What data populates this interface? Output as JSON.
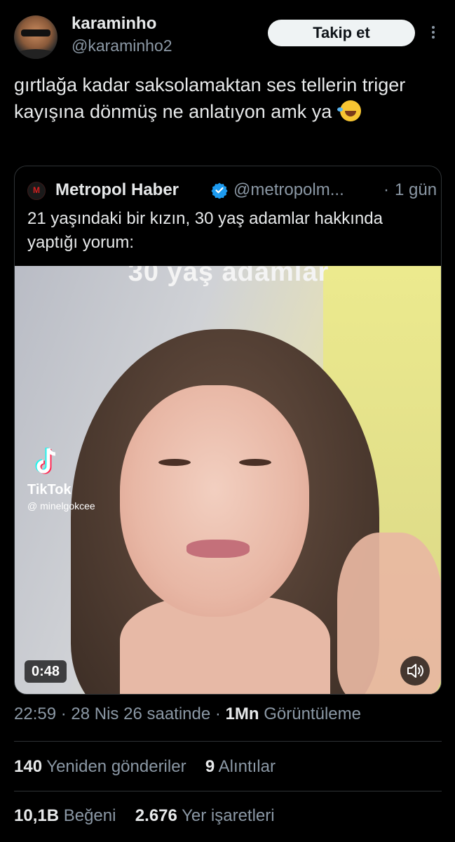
{
  "author": {
    "display_name": "karaminho",
    "handle": "@karaminho2"
  },
  "follow_label": "Takip et",
  "tweet_text": "gırtlağa kadar saksolamaktan ses tellerin triger kayışına dönmüş ne anlatıyon amk ya",
  "quote": {
    "display_name": "Metropol Haber",
    "handle": "@metropolm...",
    "separator": "·",
    "time": "1 gün",
    "text": "21 yaşındaki bir kızın, 30 yaş adamlar hakkında yaptığı yorum:",
    "video": {
      "caption": "30 yaş adamlar",
      "watermark_brand": "TikTok",
      "watermark_user": "@ minelgokcee",
      "duration": "0:48"
    }
  },
  "meta": {
    "time": "22:59",
    "dot1": "·",
    "date": "28 Nis 26 saatinde",
    "dot2": "·",
    "views_count": "1Mn",
    "views_label": "Görüntüleme"
  },
  "stats": {
    "reposts_count": "140",
    "reposts_label": "Yeniden gönderiler",
    "quotes_count": "9",
    "quotes_label": "Alıntılar",
    "likes_count": "10,1B",
    "likes_label": "Beğeni",
    "bookmarks_count": "2.676",
    "bookmarks_label": "Yer işaretleri"
  },
  "colors": {
    "background": "#000000",
    "text_primary": "#e7e9ea",
    "text_secondary": "#8b98a5",
    "verified": "#1d9bf0",
    "border": "#2f3336"
  }
}
